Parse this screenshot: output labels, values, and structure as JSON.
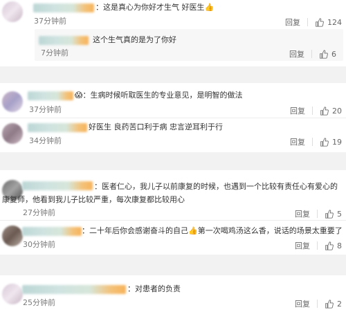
{
  "actions": {
    "reply": "回复"
  },
  "comments": [
    {
      "text": "：这是真心为你好才生气 好医生👍",
      "time": "37分钟前",
      "likes": "124"
    },
    {
      "text": "这个生气真的是为了你好",
      "time": "7分钟前",
      "likes": "6"
    },
    {
      "text": "😱：生病时候听取医生的专业意见，是明智的做法",
      "time": "37分钟前",
      "likes": "20"
    },
    {
      "text": "好医生 良药苦口利于病 忠言逆耳利于行",
      "time": "34分钟前",
      "likes": "19"
    },
    {
      "text": "：医者仁心，我儿子以前康复的时候，也遇到一个比较有责任心有爱心的康复师，他看到我儿子比较严重，每次康复都比较用心",
      "time": "27分钟前",
      "likes": "5"
    },
    {
      "text": "：二十年后你会感谢奋斗的自己👍第一次喝鸡汤这么香，说话的场景太重要了",
      "time": "30分钟前",
      "likes": "8"
    },
    {
      "text": "：对患者的负责",
      "time": "25分钟前",
      "likes": "2"
    }
  ]
}
